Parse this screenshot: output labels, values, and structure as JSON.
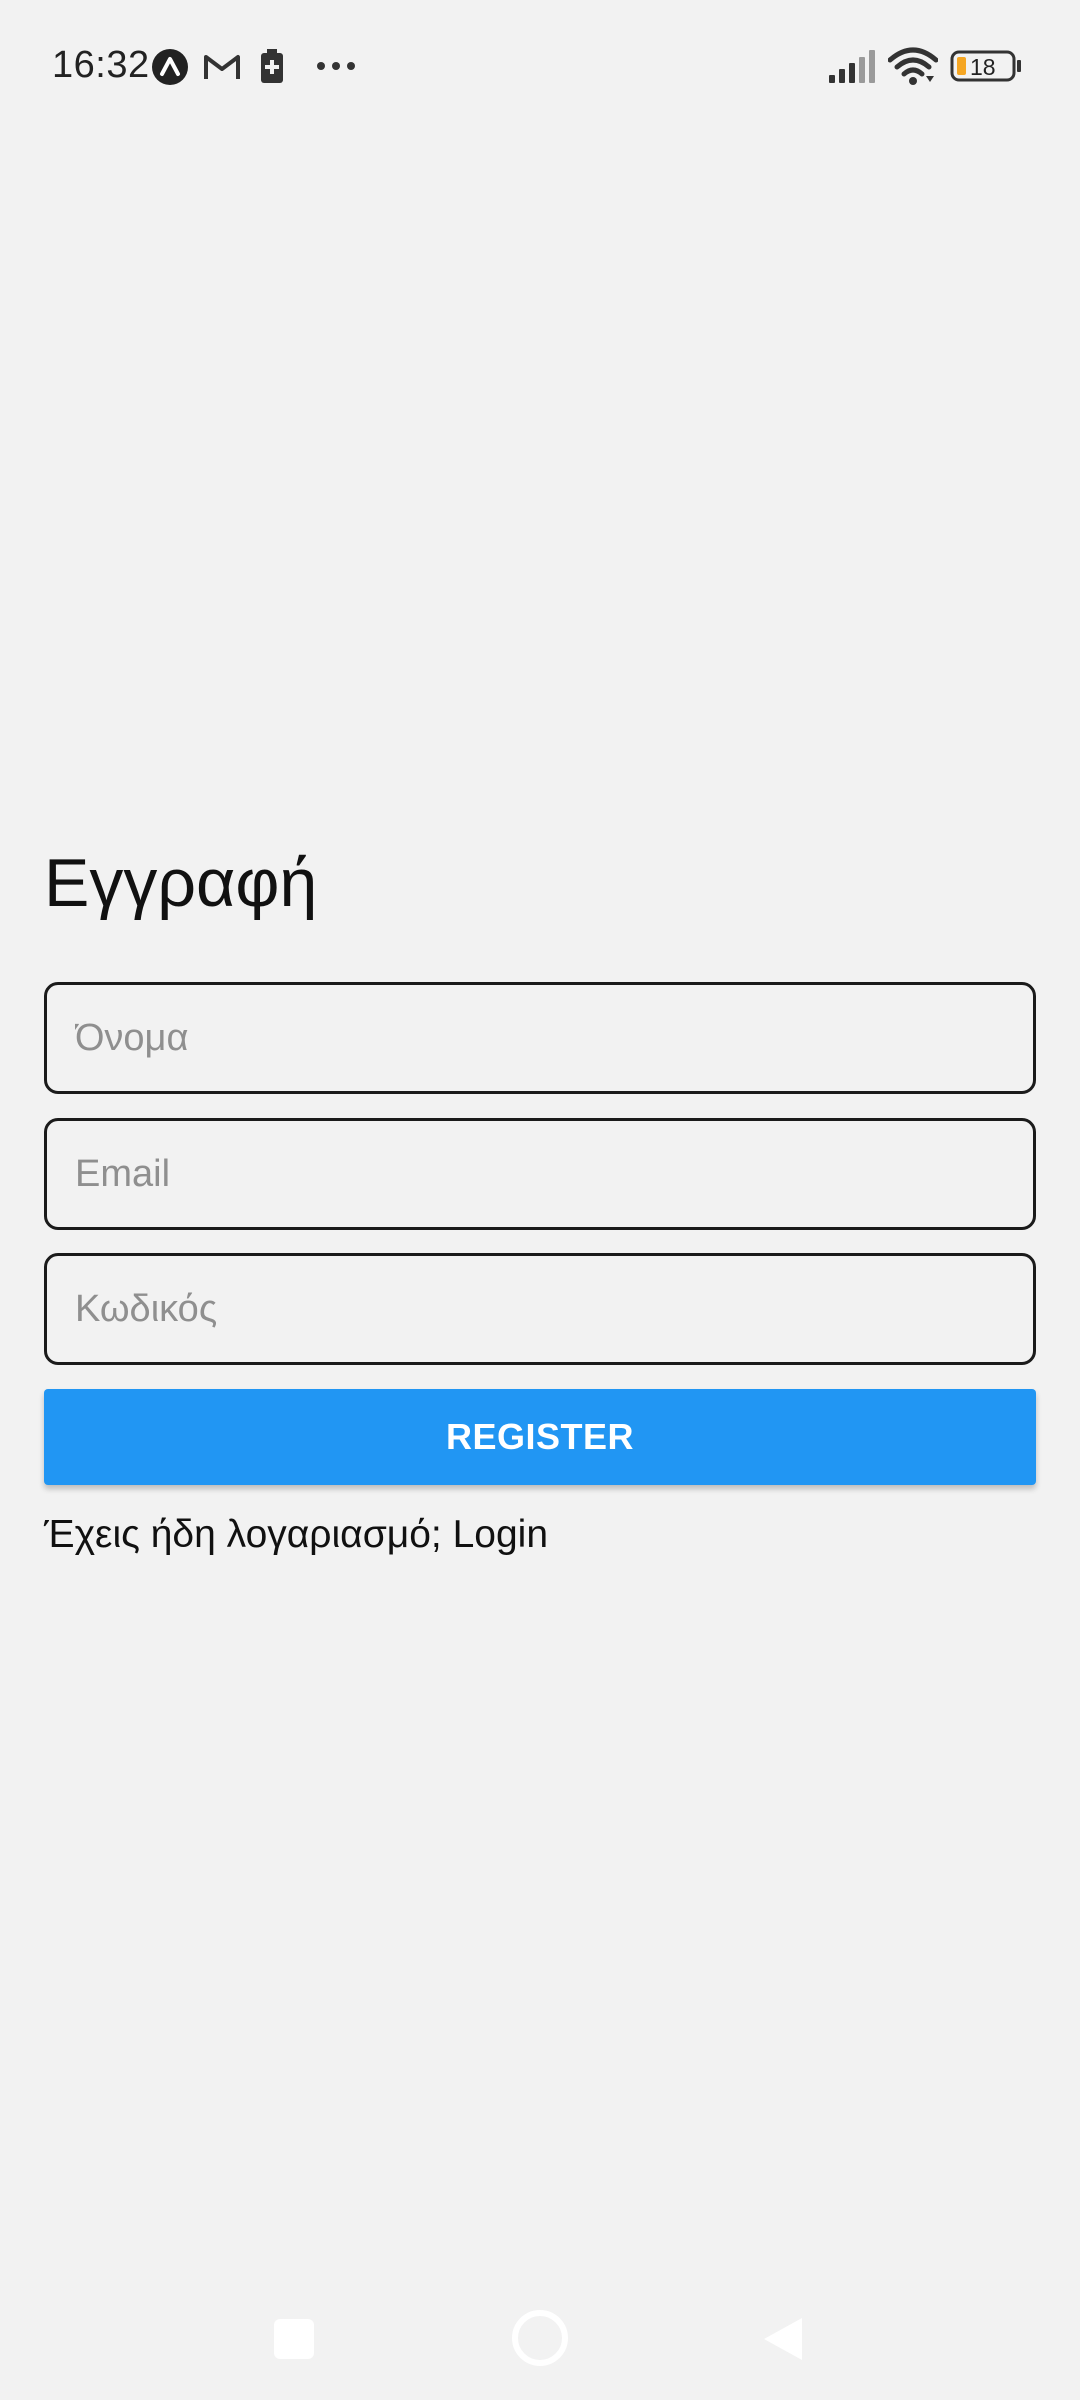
{
  "status_bar": {
    "time": "16:32",
    "left_icons": [
      "app-a-icon",
      "gmail-icon",
      "battery-saver-icon",
      "more-dots-icon"
    ],
    "right_icons": [
      "signal-icon",
      "wifi-icon",
      "battery-icon"
    ],
    "battery_level": "18",
    "battery_color": "#f5a623"
  },
  "form": {
    "title": "Εγγραφή",
    "name_placeholder": "Όνομα",
    "email_placeholder": "Email",
    "password_placeholder": "Κωδικός",
    "register_label": "REGISTER",
    "login_prompt": "Έχεις ήδη λογαριασμό; ",
    "login_link": "Login"
  },
  "colors": {
    "background": "#f2f2f2",
    "primary": "#2196f3",
    "field_border": "#1b1b1b"
  },
  "nav_bar": {
    "buttons": [
      "recents-square-icon",
      "home-circle-icon",
      "back-triangle-icon"
    ]
  }
}
